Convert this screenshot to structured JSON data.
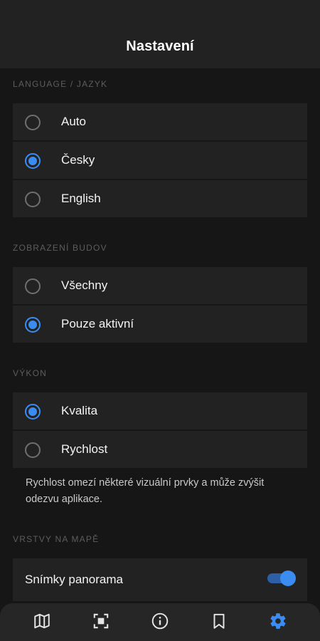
{
  "header": {
    "title": "Nastavení"
  },
  "sections": {
    "language": {
      "label": "LANGUAGE / JAZYK",
      "options": [
        {
          "label": "Auto",
          "selected": false
        },
        {
          "label": "Česky",
          "selected": true
        },
        {
          "label": "English",
          "selected": false
        }
      ]
    },
    "buildings": {
      "label": "ZOBRAZENÍ BUDOV",
      "options": [
        {
          "label": "Všechny",
          "selected": false
        },
        {
          "label": "Pouze aktivní",
          "selected": true
        }
      ]
    },
    "performance": {
      "label": "VÝKON",
      "options": [
        {
          "label": "Kvalita",
          "selected": true
        },
        {
          "label": "Rychlost",
          "selected": false
        }
      ],
      "note": "Rychlost omezí některé vizuální prvky a může zvýšit odezvu aplikace."
    },
    "layers": {
      "label": "VRSTVY NA MAPĚ",
      "items": [
        {
          "label": "Snímky panorama",
          "enabled": true
        }
      ]
    }
  },
  "bottom_nav": {
    "items": [
      {
        "icon": "map-icon",
        "active": false
      },
      {
        "icon": "scan-icon",
        "active": false
      },
      {
        "icon": "info-icon",
        "active": false
      },
      {
        "icon": "bookmark-icon",
        "active": false
      },
      {
        "icon": "gear-icon",
        "active": true
      }
    ]
  },
  "colors": {
    "accent": "#3b8cf0",
    "background": "#161616",
    "surface": "#222222",
    "section_label": "#5d5d5d"
  }
}
